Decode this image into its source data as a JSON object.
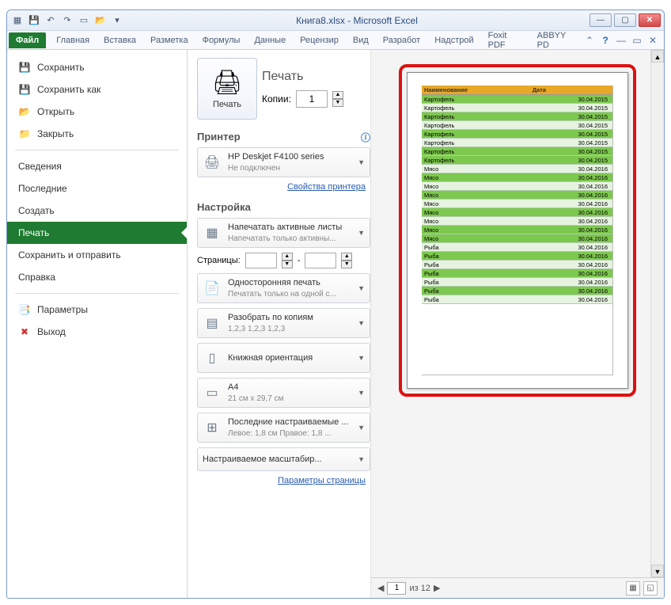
{
  "window": {
    "title": "Книга8.xlsx - Microsoft Excel"
  },
  "ribbon": {
    "file": "Файл",
    "tabs": [
      "Главная",
      "Вставка",
      "Разметка",
      "Формулы",
      "Данные",
      "Рецензир",
      "Вид",
      "Разработ",
      "Надстрой",
      "Foxit PDF",
      "ABBYY PD"
    ]
  },
  "sidebar": {
    "save": "Сохранить",
    "save_as": "Сохранить как",
    "open": "Открыть",
    "close": "Закрыть",
    "info": "Сведения",
    "recent": "Последние",
    "new": "Создать",
    "print": "Печать",
    "save_send": "Сохранить и отправить",
    "help": "Справка",
    "options": "Параметры",
    "exit": "Выход"
  },
  "print": {
    "heading": "Печать",
    "button": "Печать",
    "copies_label": "Копии:",
    "copies_value": "1",
    "printer_heading": "Принтер",
    "printer_name": "HP Deskjet F4100 series",
    "printer_status": "Не подключен",
    "printer_props": "Свойства принтера",
    "settings_heading": "Настройка",
    "print_active": {
      "l1": "Напечатать активные листы",
      "l2": "Напечатать только активны..."
    },
    "pages_label": "Страницы:",
    "pages_to": "-",
    "one_sided": {
      "l1": "Односторонняя печать",
      "l2": "Печатать только на одной с..."
    },
    "collate": {
      "l1": "Разобрать по копиям",
      "l2": "1,2,3   1,2,3   1,2,3"
    },
    "orientation": "Книжная ориентация",
    "paper": {
      "l1": "A4",
      "l2": "21 см x 29,7 см"
    },
    "margins": {
      "l1": "Последние настраиваемые ...",
      "l2": "Левое: 1,8 см   Правое: 1,8 ..."
    },
    "scaling": "Настраиваемое масштабир...",
    "page_setup": "Параметры страницы"
  },
  "preview": {
    "headers": [
      "Наименование",
      "Дата"
    ],
    "rows": [
      {
        "n": "Картофель",
        "d": "30.04.2015",
        "c": "g"
      },
      {
        "n": "Картофель",
        "d": "30.04.2015",
        "c": "w"
      },
      {
        "n": "Картофель",
        "d": "30.04.2015",
        "c": "g"
      },
      {
        "n": "Картофель",
        "d": "30.04.2015",
        "c": "w"
      },
      {
        "n": "Картофель",
        "d": "30.04.2015",
        "c": "g"
      },
      {
        "n": "Картофель",
        "d": "30.04.2015",
        "c": "w"
      },
      {
        "n": "Картофель",
        "d": "30.04.2015",
        "c": "g"
      },
      {
        "n": "Картофель",
        "d": "30.04.2015",
        "c": "g"
      },
      {
        "n": "Мясо",
        "d": "30.04.2016",
        "c": "w"
      },
      {
        "n": "Мясо",
        "d": "30.04.2016",
        "c": "g"
      },
      {
        "n": "Мясо",
        "d": "30.04.2016",
        "c": "w"
      },
      {
        "n": "Мясо",
        "d": "30.04.2016",
        "c": "g"
      },
      {
        "n": "Мясо",
        "d": "30.04.2016",
        "c": "w"
      },
      {
        "n": "Мясо",
        "d": "30.04.2016",
        "c": "g"
      },
      {
        "n": "Мясо",
        "d": "30.04.2016",
        "c": "w"
      },
      {
        "n": "Мясо",
        "d": "30.04.2016",
        "c": "g"
      },
      {
        "n": "Мясо",
        "d": "30.04.2016",
        "c": "g"
      },
      {
        "n": "Рыба",
        "d": "30.04.2016",
        "c": "w"
      },
      {
        "n": "Рыба",
        "d": "30.04.2016",
        "c": "g"
      },
      {
        "n": "Рыба",
        "d": "30.04.2016",
        "c": "w"
      },
      {
        "n": "Рыба",
        "d": "30.04.2016",
        "c": "g"
      },
      {
        "n": "Рыба",
        "d": "30.04.2016",
        "c": "w"
      },
      {
        "n": "Рыба",
        "d": "30.04.2016",
        "c": "g"
      },
      {
        "n": "Рыба",
        "d": "30.04.2016",
        "c": "w"
      }
    ],
    "page_current": "1",
    "page_total": "из 12"
  }
}
